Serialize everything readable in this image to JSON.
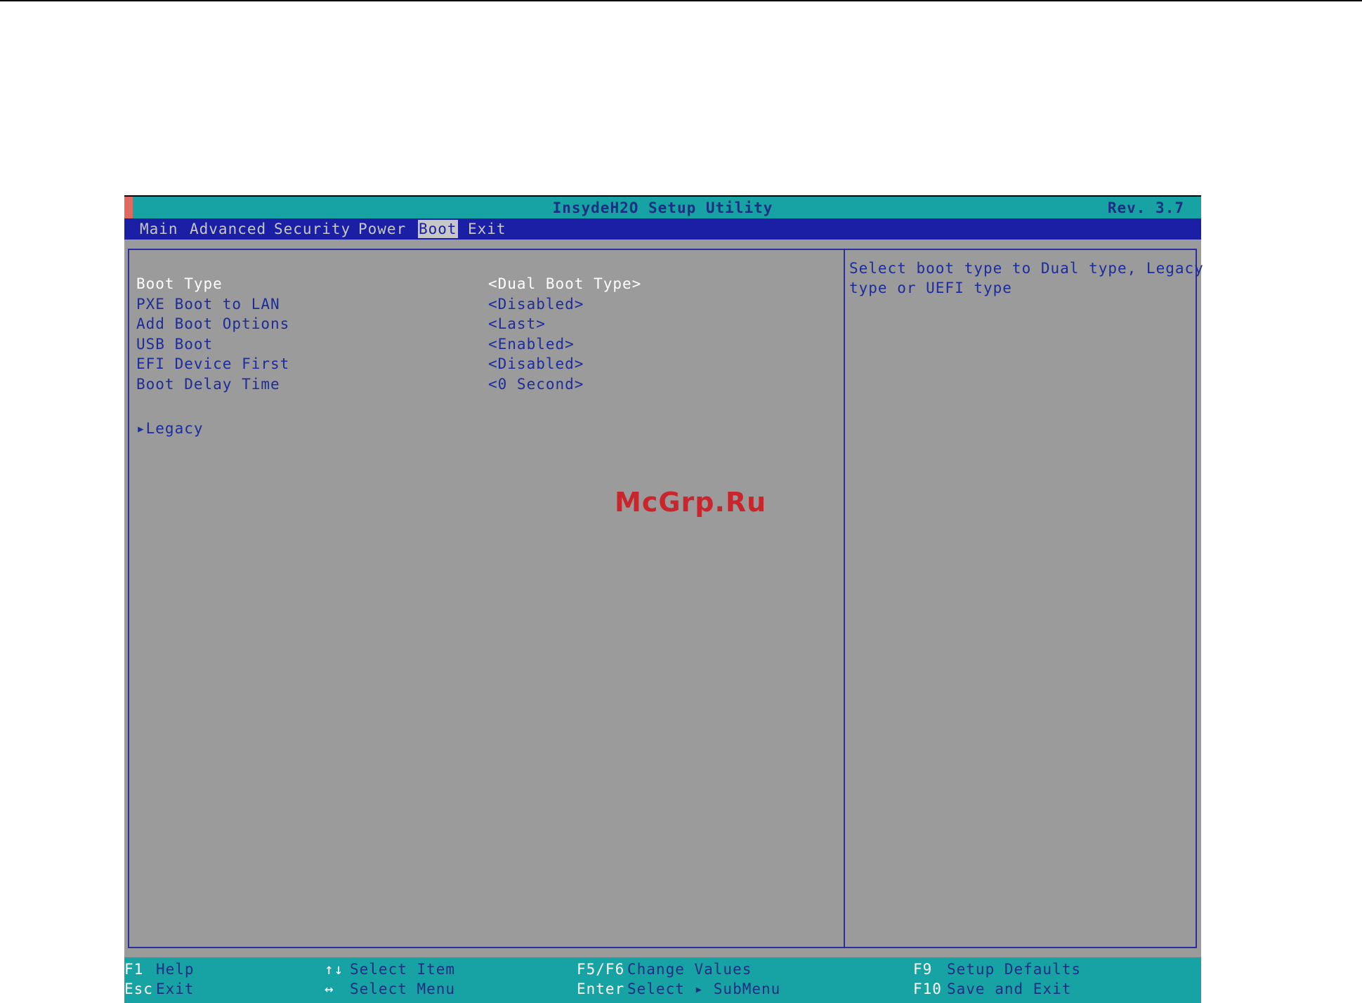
{
  "header": {
    "title": "InsydeH2O Setup Utility",
    "revision": "Rev. 3.7"
  },
  "menu": {
    "tabs": [
      "Main",
      "Advanced",
      "Security",
      "Power",
      "Boot",
      "Exit"
    ],
    "active": "Boot"
  },
  "settings": [
    {
      "label": "Boot Type",
      "value": "<Dual Boot Type>"
    },
    {
      "label": "PXE Boot to LAN",
      "value": "<Disabled>"
    },
    {
      "label": "Add Boot Options",
      "value": "<Last>"
    },
    {
      "label": "USB Boot",
      "value": "<Enabled>"
    },
    {
      "label": "EFI Device First",
      "value": "<Disabled>"
    },
    {
      "label": "Boot Delay Time",
      "value": "<0 Second>"
    }
  ],
  "submenu": {
    "label": "▸Legacy"
  },
  "help": {
    "lines": [
      "Select boot type to Dual type, Legacy",
      "type or UEFI type"
    ]
  },
  "footer": {
    "f1_key": "F1",
    "f1_desc": "Help",
    "esc_key": "Esc",
    "esc_desc": "Exit",
    "arrows_ud_key": "↑↓",
    "arrows_ud_desc": "Select Item",
    "arrows_lr_key": "↔",
    "arrows_lr_desc": "Select Menu",
    "f5f6_key": "F5/F6",
    "f5f6_desc": "Change Values",
    "enter_key": "Enter",
    "enter_desc": "Select ▸ SubMenu",
    "f9_key": "F9",
    "f9_desc": "Setup Defaults",
    "f10_key": "F10",
    "f10_desc": "Save and Exit"
  },
  "watermark": "McGrp.Ru",
  "colors": {
    "title_bar": "#17a2a4",
    "menu_bar": "#1a1fa5",
    "panel_background": "#9b9b9b",
    "text_blue": "#1c2c9a",
    "selected_text": "#ffffff",
    "watermark": "#c8262c"
  }
}
